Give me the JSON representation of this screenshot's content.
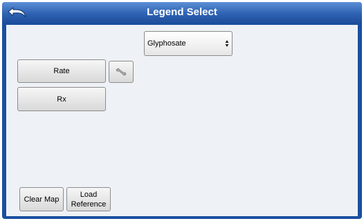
{
  "window": {
    "title": "Legend Select",
    "back_icon": "back-arrow-icon"
  },
  "product_select": {
    "selected": "Glyphosate",
    "icon": "updown-arrows-icon"
  },
  "buttons": {
    "rate": "Rate",
    "tool_icon": "wrench-icon",
    "rx": "Rx",
    "clear_map": "Clear Map",
    "load_reference_line1": "Load",
    "load_reference_line2": "Reference"
  },
  "colors": {
    "titlebar": "#2f63b3",
    "frame": "#1a4fa0",
    "content_bg": "#eef1f6"
  }
}
